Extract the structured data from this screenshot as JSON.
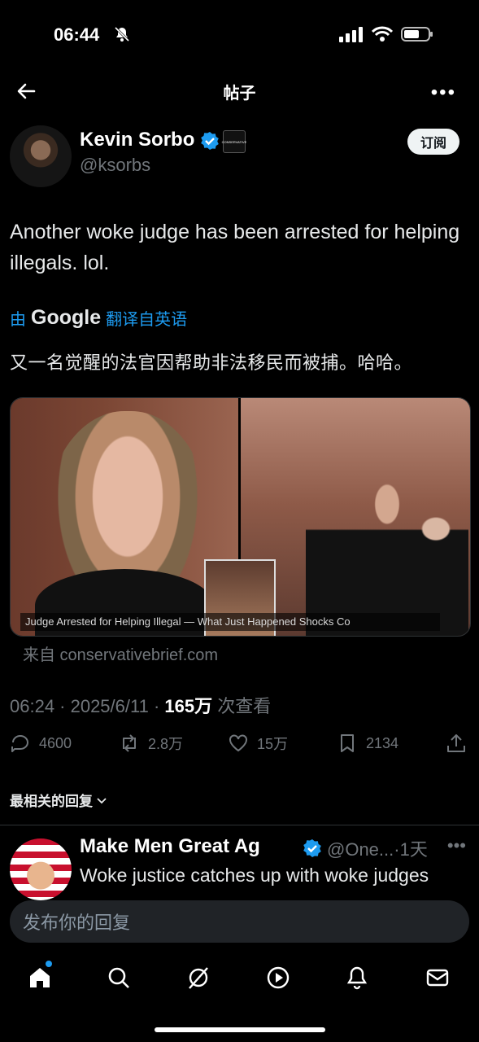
{
  "status": {
    "time": "06:44"
  },
  "header": {
    "title": "帖子"
  },
  "author": {
    "name": "Kevin Sorbo",
    "handle": "@ksorbs",
    "subscribe_label": "订阅",
    "affiliate_badge": "CONSERVATIVE"
  },
  "post": {
    "text": "Another woke judge has been arrested for helping illegals. lol.",
    "translated_prefix": "由",
    "translated_google": "Google",
    "translated_suffix": "翻译自英语",
    "translation": "又一名觉醒的法官因帮助非法移民而被捕。哈哈。",
    "media_caption": "Judge Arrested for Helping Illegal — What Just Happened Shocks Co",
    "source": "来自 conservativebrief.com",
    "meta_time": "06:24 · 2025/6/11 · ",
    "views_count": "165万",
    "views_label": " 次查看"
  },
  "actions": {
    "replies": "4600",
    "reposts": "2.8万",
    "likes": "15万",
    "bookmarks": "2134"
  },
  "sort": {
    "label": "最相关的回复"
  },
  "reply": {
    "name": "Make Men Great Ag",
    "handle": "@One...·1天",
    "text": "Woke justice catches up with woke judges"
  },
  "compose": {
    "placeholder": "发布你的回复"
  },
  "colors": {
    "accent": "#1d9bf0",
    "background": "#000000",
    "muted": "#71767b"
  }
}
